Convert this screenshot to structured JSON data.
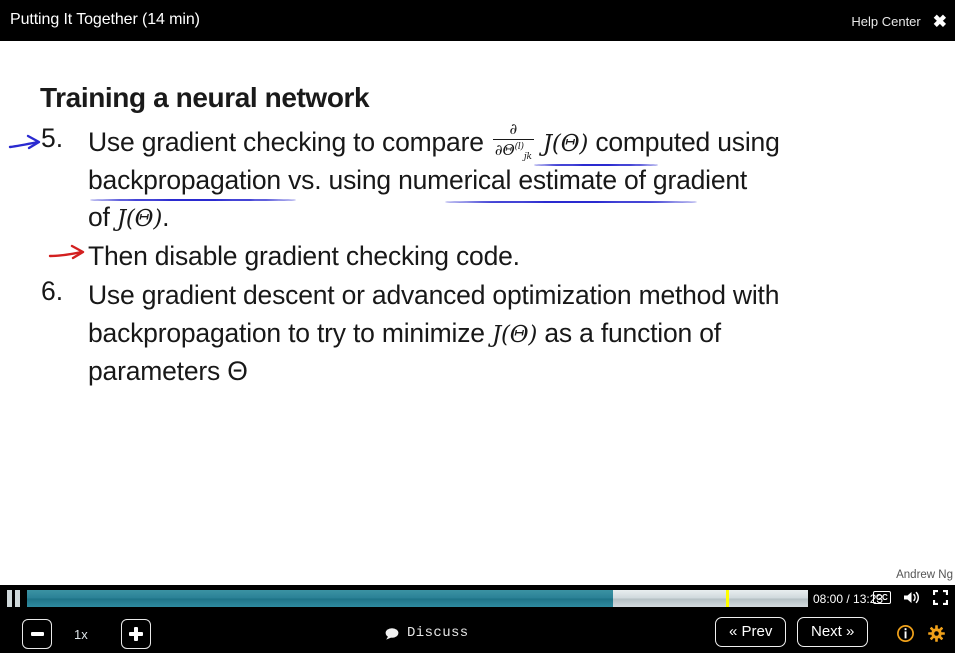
{
  "topbar": {
    "title": "Putting It Together (14 min)",
    "help_center": "Help Center",
    "close_label": "✖"
  },
  "slide": {
    "title": "Training a neural network",
    "attribution": "Andrew Ng",
    "items": [
      {
        "number": "5.",
        "line1_before": "Use gradient checking to compare",
        "formula": {
          "numerator": "∂",
          "denominator_base": "∂Θ",
          "denominator_superscript": "(l)",
          "denominator_subscript": "jk",
          "applied_to": "J(Θ)"
        },
        "line1_after": "computed using",
        "line2_a": "backpropagation vs. using",
        "line2_b": "numerical estimate",
        "line2_c": "of gradient",
        "line3_prefix": "of",
        "line3_math": "J(Θ)",
        "line3_suffix": "."
      },
      {
        "number": "",
        "annotation": "Then disable gradient checking code."
      },
      {
        "number": "6.",
        "line1": "Use gradient descent or advanced optimization method with",
        "line2_a": "backpropagation to try to  minimize",
        "line2_math": "J(Θ)",
        "line2_b": "as a function of",
        "line3": "parameters Θ"
      }
    ],
    "annotations": {
      "blue_arrow_icon": "arrow-right-icon",
      "red_arrow_icon": "arrow-right-icon",
      "underline_color": "#2a2ad0",
      "red_arrow_color": "#d32020"
    }
  },
  "player": {
    "pause_icon": "pause-icon",
    "current_time": "08:00",
    "total_time": "13:23",
    "time_display": "08:00 / 13:23",
    "buffered_percent": 75,
    "playhead_percent": 89.5,
    "cc_label": "CC",
    "volume_icon": "volume-icon",
    "fullscreen_icon": "fullscreen-icon"
  },
  "toolbar": {
    "speed_down_icon": "minus-icon",
    "speed_label": "1x",
    "speed_up_icon": "plus-icon",
    "discuss_label": "Discuss",
    "discuss_icon": "speech-bubble-icon",
    "prev_label": "« Prev",
    "next_label": "Next »",
    "info_icon": "info-icon",
    "settings_icon": "gear-icon",
    "icon_accent_color": "#f0a11a"
  }
}
